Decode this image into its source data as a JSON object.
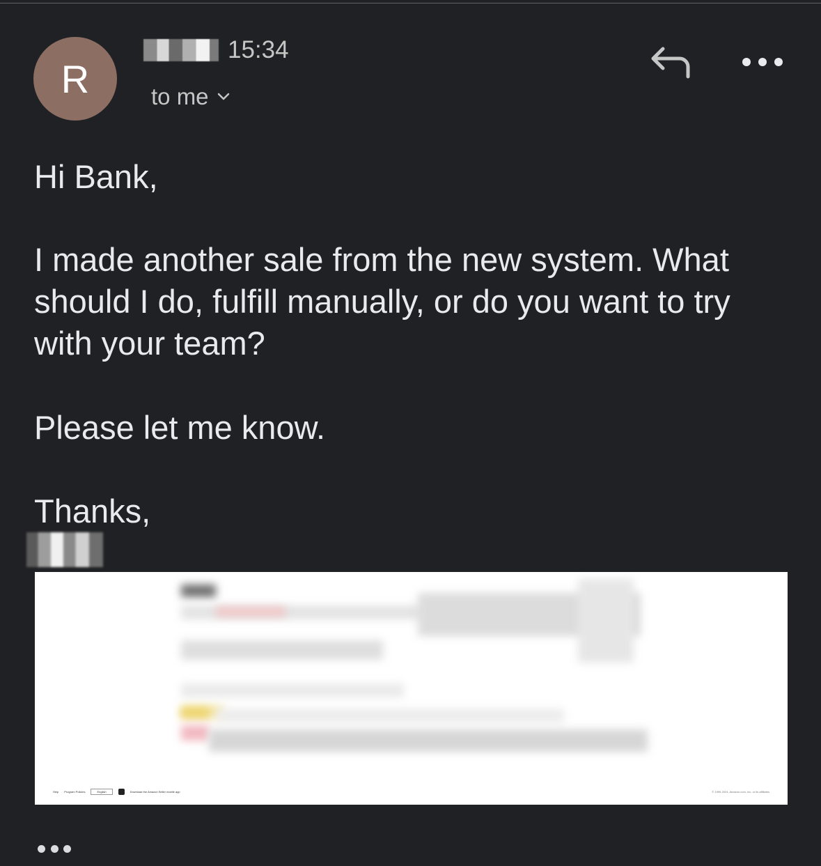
{
  "header": {
    "avatar_letter": "R",
    "time": "15:34",
    "recipients_label": "to me",
    "avatar_color": "#8d6e63"
  },
  "body": {
    "greeting": "Hi Bank,",
    "paragraph": "I made another sale from the new system. What\nshould I do, fulfill manually, or do you want to try\nwith your team?",
    "request": "Please let me know.",
    "signoff": "Thanks,"
  },
  "attachment": {
    "footer_links": [
      "Help",
      "Program Policies"
    ],
    "language_select": "English",
    "app_promo": "Download the Amazon Seller mobile app",
    "copyright": "© 1999-2024, Amazon.com, Inc. or its affiliates"
  },
  "icons": {
    "reply": "reply-icon",
    "more": "more-vert-icon",
    "chevron": "chevron-down-icon"
  },
  "colors": {
    "background": "#202124",
    "text": "#e8eaed",
    "secondary_text": "#c4c7c5"
  }
}
